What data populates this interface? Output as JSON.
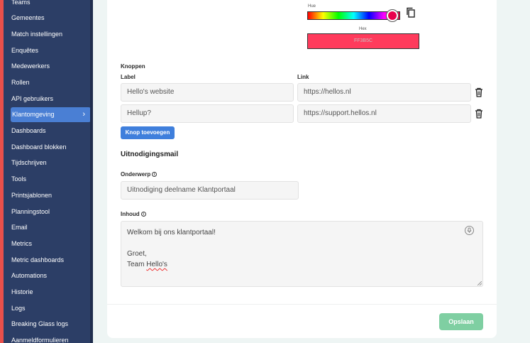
{
  "sidebar": {
    "items": [
      {
        "label": "Teams"
      },
      {
        "label": "Gemeentes"
      },
      {
        "label": "Match instellingen"
      },
      {
        "label": "Enquêtes"
      },
      {
        "label": "Medewerkers"
      },
      {
        "label": "Rollen"
      },
      {
        "label": "API gebruikers"
      },
      {
        "label": "Klantomgeving",
        "active": true
      },
      {
        "label": "Dashboards"
      },
      {
        "label": "Dashboard blokken"
      },
      {
        "label": "Tijdschrijven"
      },
      {
        "label": "Tools"
      },
      {
        "label": "Printsjablonen"
      },
      {
        "label": "Planningstool"
      },
      {
        "label": "Email"
      },
      {
        "label": "Metrics"
      },
      {
        "label": "Metric dashboards"
      },
      {
        "label": "Automations"
      },
      {
        "label": "Historie"
      },
      {
        "label": "Logs"
      },
      {
        "label": "Breaking Glass logs"
      },
      {
        "label": "Aanmeldformulieren"
      }
    ]
  },
  "color_picker": {
    "hue_label": "Hue",
    "hex_label": "Hex",
    "hex_value": "FF3B5C",
    "color": "#ff3b5c"
  },
  "buttons_section": {
    "title": "Knoppen",
    "label_header": "Label",
    "link_header": "Link",
    "rows": [
      {
        "label": "Hello's website",
        "link": "https://hellos.nl"
      },
      {
        "label": "Hellup?",
        "link": "https://support.hellos.nl"
      }
    ],
    "add_button": "Knop toevoegen"
  },
  "invitation_mail": {
    "heading": "Uitnodigingsmail",
    "subject_label": "Onderwerp",
    "subject_value": "Uitnodiging deelname Klantportaal",
    "content_label": "Inhoud",
    "content_lines": [
      "Welkom bij ons klantportaal!",
      "",
      "Groet,",
      "Team "
    ],
    "content_squiggle": "Hello's"
  },
  "save_button": "Opslaan",
  "colors": {
    "sidebar_bg": "#2c3e66",
    "sidebar_active": "#4a7fd4",
    "accent_red": "#e9504b",
    "primary_button": "#3f7fdc",
    "save_button": "#7fcfa2"
  }
}
